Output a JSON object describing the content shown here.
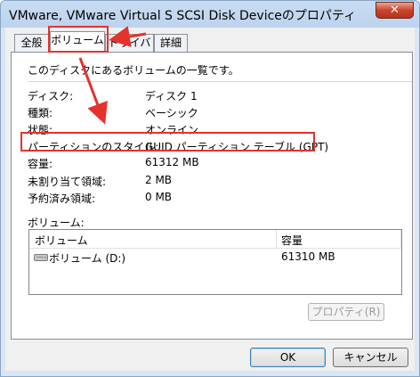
{
  "window": {
    "title": "VMware, VMware Virtual S SCSI Disk Deviceのプロパティ",
    "close_glyph": "✕"
  },
  "tabs": [
    {
      "label": "全般"
    },
    {
      "label": "ボリューム",
      "active": true
    },
    {
      "label": "ドライバー"
    },
    {
      "label": "詳細"
    }
  ],
  "panel": {
    "description": "このディスクにあるボリュームの一覧です。",
    "properties": [
      {
        "label": "ディスク:",
        "value": "ディスク 1"
      },
      {
        "label": "種類:",
        "value": "ベーシック"
      },
      {
        "label": "状態:",
        "value": "オンライン"
      },
      {
        "label": "パーティションのスタイル:",
        "value": "GUID パーティション テーブル (GPT)"
      },
      {
        "label": "容量:",
        "value": "61312 MB"
      },
      {
        "label": "未割り当て領域:",
        "value": "2 MB"
      },
      {
        "label": "予約済み領域:",
        "value": "0 MB"
      }
    ],
    "volumes_label": "ボリューム:",
    "volume_table": {
      "headers": [
        "ボリューム",
        "容量"
      ],
      "rows": [
        {
          "name": "ボリューム (D:)",
          "capacity": "61310 MB"
        }
      ]
    },
    "properties_button": "プロパティ(R)"
  },
  "buttons": {
    "ok": "OK",
    "cancel": "キャンセル"
  },
  "annotation_color": "#e5322d"
}
